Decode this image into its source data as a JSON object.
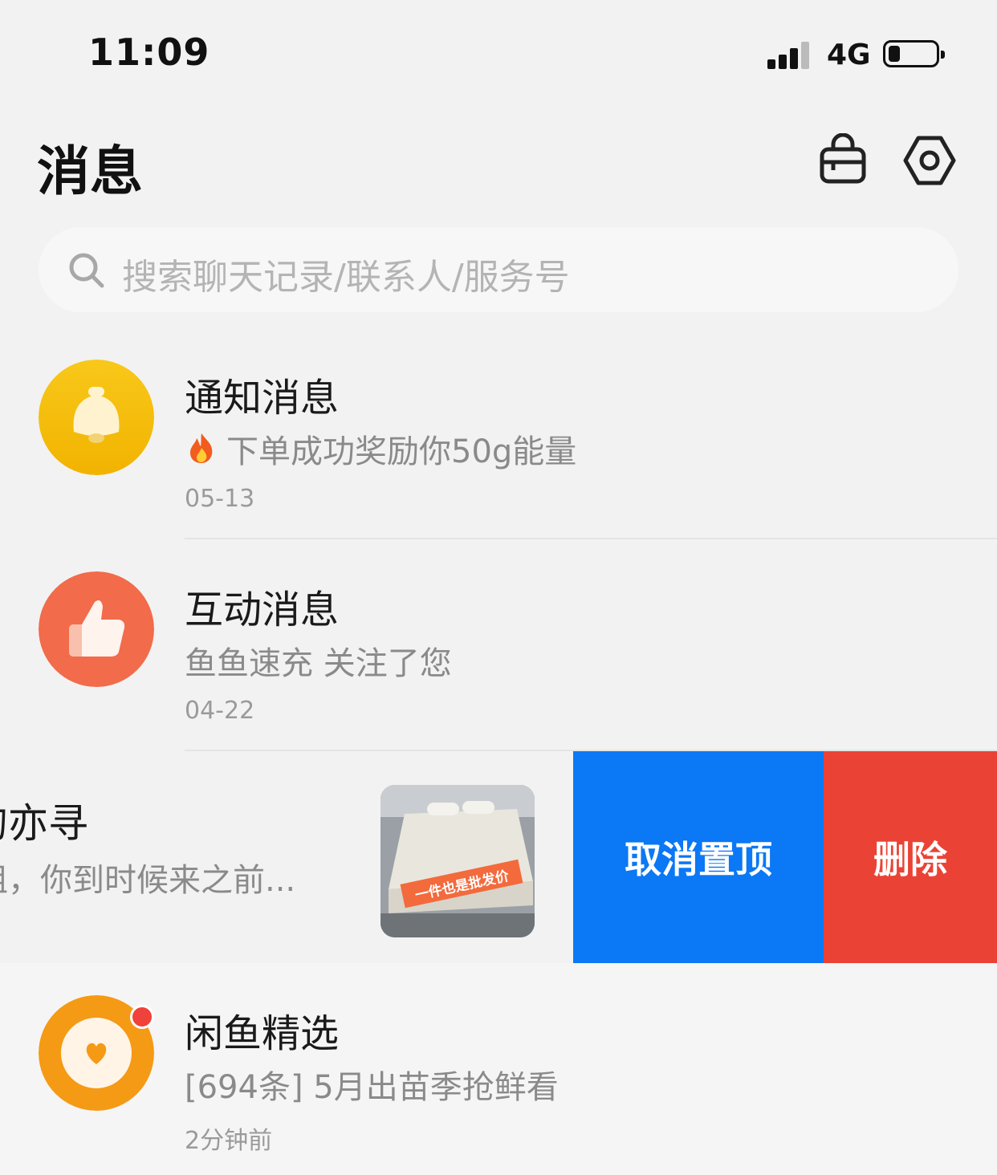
{
  "status_bar": {
    "time": "11:09",
    "network": "4G"
  },
  "header": {
    "title": "消息",
    "icons": [
      "shopping-bag-icon",
      "settings-icon"
    ]
  },
  "search": {
    "placeholder": "搜索聊天记录/联系人/服务号"
  },
  "conversations": [
    {
      "title": "通知消息",
      "preview": "下单成功奖励你50g能量",
      "time": "05-13",
      "icon": "bell-icon",
      "color": "#f7c012",
      "prefix_icon": "fire-icon"
    },
    {
      "title": "互动消息",
      "preview": "鱼鱼速充 关注了您",
      "time": "04-22",
      "icon": "thumbs-up-icon",
      "color": "#f26b4a"
    }
  ],
  "swiped_conversation": {
    "title": "的亦寻",
    "preview": "姐，你到时候来之前...",
    "thumbnail_caption": "一件也是批发价",
    "actions": {
      "unpin": "取消置顶",
      "delete": "删除"
    }
  },
  "bottom_conversation": {
    "title": "闲鱼精选",
    "preview": "[694条] 5月出苗季抢鲜看",
    "time": "2分钟前",
    "icon": "heart-icon",
    "color": "#f59a14",
    "unread_dot": true
  }
}
